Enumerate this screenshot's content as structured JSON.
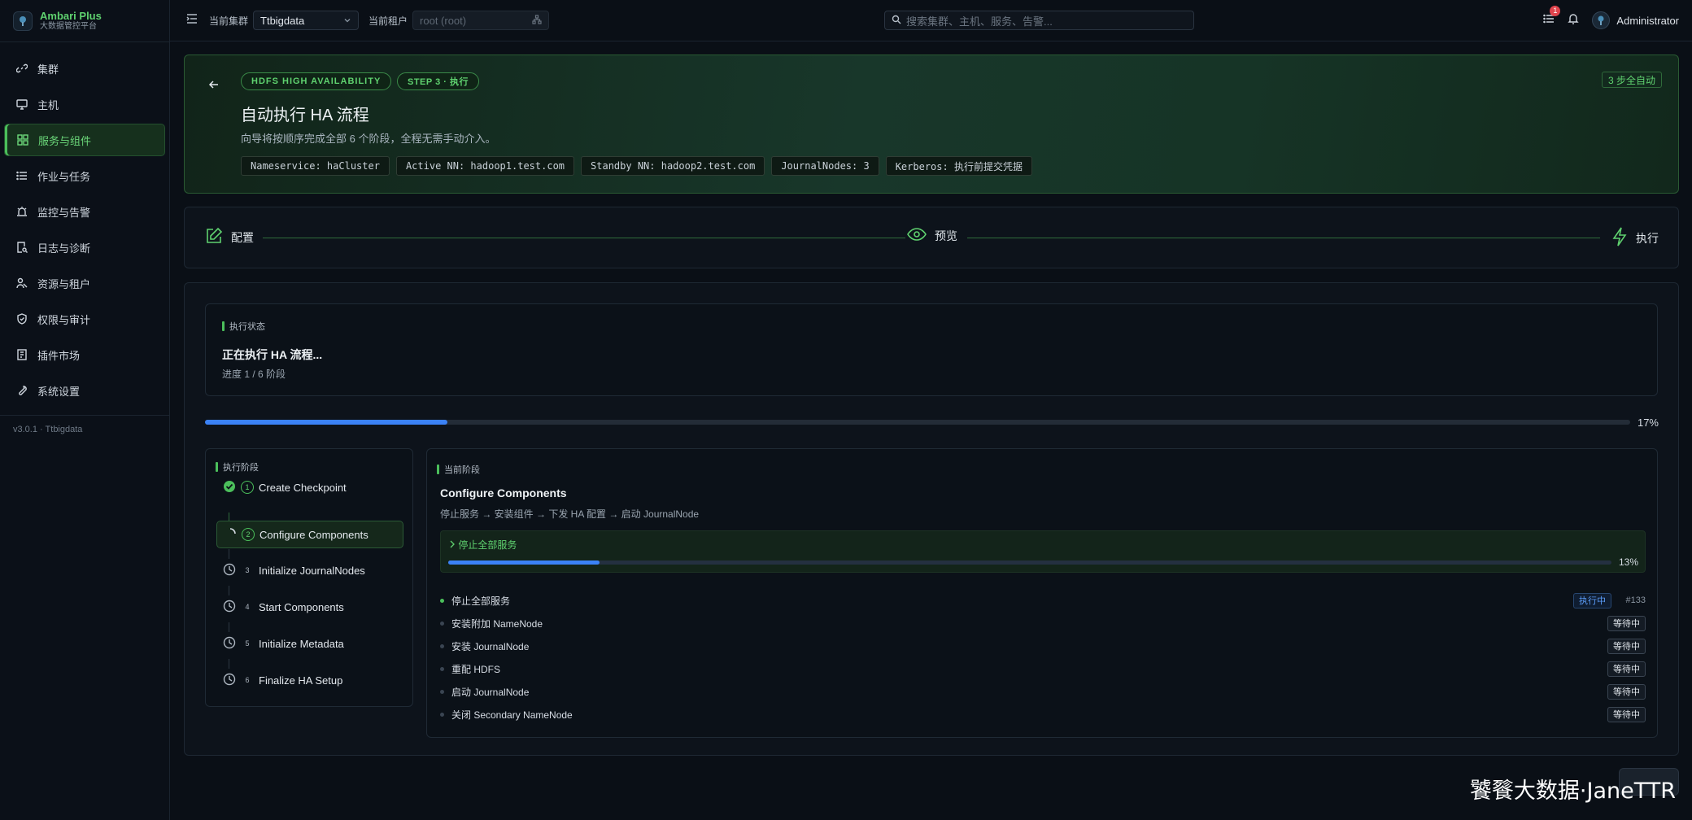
{
  "brand": {
    "title": "Ambari Plus",
    "subtitle": "大数据管控平台"
  },
  "sidebar": {
    "items": [
      {
        "label": "集群",
        "icon": "link-icon"
      },
      {
        "label": "主机",
        "icon": "monitor-icon"
      },
      {
        "label": "服务与组件",
        "icon": "grid-icon",
        "active": true
      },
      {
        "label": "作业与任务",
        "icon": "list-icon"
      },
      {
        "label": "监控与告警",
        "icon": "alarm-icon"
      },
      {
        "label": "日志与诊断",
        "icon": "document-search-icon"
      },
      {
        "label": "资源与租户",
        "icon": "users-icon"
      },
      {
        "label": "权限与审计",
        "icon": "shield-icon"
      },
      {
        "label": "插件市场",
        "icon": "store-icon"
      },
      {
        "label": "系统设置",
        "icon": "wrench-icon"
      }
    ],
    "version": "v3.0.1 · Ttbigdata"
  },
  "topbar": {
    "cluster_label": "当前集群",
    "cluster_value": "Ttbigdata",
    "tenant_label": "当前租户",
    "tenant_placeholder": "root (root)",
    "search_placeholder": "搜索集群、主机、服务、告警...",
    "notification_count": "1",
    "user": "Administrator"
  },
  "hero": {
    "pill_1": "HDFS HIGH AVAILABILITY",
    "pill_2": "STEP 3 · 执行",
    "auto_badge": "3 步全自动",
    "title": "自动执行 HA 流程",
    "description": "向导将按顺序完成全部 6 个阶段，全程无需手动介入。",
    "chips": [
      "Nameservice: haCluster",
      "Active NN: hadoop1.test.com",
      "Standby NN: hadoop2.test.com",
      "JournalNodes: 3",
      "Kerberos: 执行前提交凭据"
    ]
  },
  "steps": [
    {
      "label": "配置",
      "icon": "edit-icon"
    },
    {
      "label": "预览",
      "icon": "eye-icon"
    },
    {
      "label": "执行",
      "icon": "lightning-icon"
    }
  ],
  "status": {
    "section_label": "执行状态",
    "title": "正在执行 HA 流程...",
    "progress_text": "进度 1 / 6 阶段",
    "progress_percent_label": "17%",
    "progress_fraction": 0.17
  },
  "phases": {
    "section_label": "执行阶段",
    "items": [
      {
        "num": "1",
        "label": "Create Checkpoint",
        "state": "done"
      },
      {
        "num": "2",
        "label": "Configure Components",
        "state": "running"
      },
      {
        "num": "3",
        "label": "Initialize JournalNodes",
        "state": "pending"
      },
      {
        "num": "4",
        "label": "Start Components",
        "state": "pending"
      },
      {
        "num": "5",
        "label": "Initialize Metadata",
        "state": "pending"
      },
      {
        "num": "6",
        "label": "Finalize HA Setup",
        "state": "pending"
      }
    ]
  },
  "current": {
    "section_label": "当前阶段",
    "title": "Configure Components",
    "flow": "停止服务 → 安装组件 → 下发 HA 配置 → 启动 JournalNode",
    "subtask_name": "停止全部服务",
    "subtask_percent_label": "13%",
    "subtask_fraction": 0.13,
    "tasks": [
      {
        "label": "停止全部服务",
        "status": "执行中",
        "id": "#133",
        "running": true
      },
      {
        "label": "安装附加 NameNode",
        "status": "等待中"
      },
      {
        "label": "安装 JournalNode",
        "status": "等待中"
      },
      {
        "label": "重配 HDFS",
        "status": "等待中"
      },
      {
        "label": "启动 JournalNode",
        "status": "等待中"
      },
      {
        "label": "关闭 Secondary NameNode",
        "status": "等待中"
      }
    ]
  },
  "watermark": "饕餮大数据·JaneTTR",
  "colors": {
    "accent": "#4bbf5b",
    "progress": "#3b82f6",
    "background": "#0a0f16"
  }
}
